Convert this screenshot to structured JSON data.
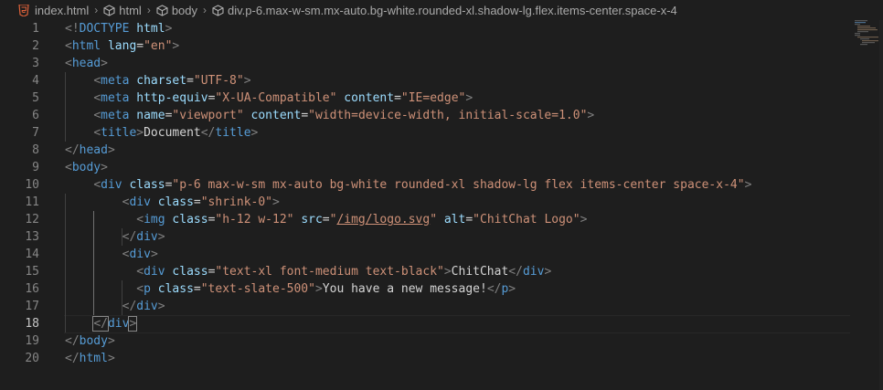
{
  "breadcrumb": [
    {
      "label": "index.html",
      "icon": "html5-icon"
    },
    {
      "label": "html",
      "icon": "cube-icon"
    },
    {
      "label": "body",
      "icon": "cube-icon"
    },
    {
      "label": "div.p-6.max-w-sm.mx-auto.bg-white.rounded-xl.shadow-lg.flex.items-center.space-x-4",
      "icon": "cube-icon"
    }
  ],
  "active_line": 18,
  "lines": [
    {
      "n": "1",
      "parts": [
        [
          "br",
          "<!"
        ],
        [
          "t",
          "DOCTYPE"
        ],
        [
          "tx",
          " "
        ],
        [
          "a",
          "html"
        ],
        [
          "br",
          ">"
        ]
      ]
    },
    {
      "n": "2",
      "parts": [
        [
          "br",
          "<"
        ],
        [
          "t",
          "html"
        ],
        [
          "tx",
          " "
        ],
        [
          "a",
          "lang"
        ],
        [
          "tx",
          "="
        ],
        [
          "s",
          "\"en\""
        ],
        [
          "br",
          ">"
        ]
      ]
    },
    {
      "n": "3",
      "parts": [
        [
          "br",
          "<"
        ],
        [
          "t",
          "head"
        ],
        [
          "br",
          ">"
        ]
      ]
    },
    {
      "n": "4",
      "parts": [
        [
          "tx",
          "    "
        ],
        [
          "br",
          "<"
        ],
        [
          "t",
          "meta"
        ],
        [
          "tx",
          " "
        ],
        [
          "a",
          "charset"
        ],
        [
          "tx",
          "="
        ],
        [
          "s",
          "\"UTF-8\""
        ],
        [
          "br",
          ">"
        ]
      ]
    },
    {
      "n": "5",
      "parts": [
        [
          "tx",
          "    "
        ],
        [
          "br",
          "<"
        ],
        [
          "t",
          "meta"
        ],
        [
          "tx",
          " "
        ],
        [
          "a",
          "http-equiv"
        ],
        [
          "tx",
          "="
        ],
        [
          "s",
          "\"X-UA-Compatible\""
        ],
        [
          "tx",
          " "
        ],
        [
          "a",
          "content"
        ],
        [
          "tx",
          "="
        ],
        [
          "s",
          "\"IE=edge\""
        ],
        [
          "br",
          ">"
        ]
      ]
    },
    {
      "n": "6",
      "parts": [
        [
          "tx",
          "    "
        ],
        [
          "br",
          "<"
        ],
        [
          "t",
          "meta"
        ],
        [
          "tx",
          " "
        ],
        [
          "a",
          "name"
        ],
        [
          "tx",
          "="
        ],
        [
          "s",
          "\"viewport\""
        ],
        [
          "tx",
          " "
        ],
        [
          "a",
          "content"
        ],
        [
          "tx",
          "="
        ],
        [
          "s",
          "\"width=device-width, initial-scale=1.0\""
        ],
        [
          "br",
          ">"
        ]
      ]
    },
    {
      "n": "7",
      "parts": [
        [
          "tx",
          "    "
        ],
        [
          "br",
          "<"
        ],
        [
          "t",
          "title"
        ],
        [
          "br",
          ">"
        ],
        [
          "tx",
          "Document"
        ],
        [
          "br",
          "</"
        ],
        [
          "t",
          "title"
        ],
        [
          "br",
          ">"
        ]
      ]
    },
    {
      "n": "8",
      "parts": [
        [
          "br",
          "</"
        ],
        [
          "t",
          "head"
        ],
        [
          "br",
          ">"
        ]
      ]
    },
    {
      "n": "9",
      "parts": [
        [
          "br",
          "<"
        ],
        [
          "t",
          "body"
        ],
        [
          "br",
          ">"
        ]
      ]
    },
    {
      "n": "10",
      "parts": [
        [
          "tx",
          "    "
        ],
        [
          "br",
          "<"
        ],
        [
          "t",
          "div"
        ],
        [
          "tx",
          " "
        ],
        [
          "a",
          "class"
        ],
        [
          "tx",
          "="
        ],
        [
          "s",
          "\"p-6 max-w-sm mx-auto bg-white rounded-xl shadow-lg flex items-center space-x-4\""
        ],
        [
          "br",
          ">"
        ]
      ]
    },
    {
      "n": "11",
      "parts": [
        [
          "tx",
          "        "
        ],
        [
          "br",
          "<"
        ],
        [
          "t",
          "div"
        ],
        [
          "tx",
          " "
        ],
        [
          "a",
          "class"
        ],
        [
          "tx",
          "="
        ],
        [
          "s",
          "\"shrink-0\""
        ],
        [
          "br",
          ">"
        ]
      ]
    },
    {
      "n": "12",
      "parts": [
        [
          "tx",
          "          "
        ],
        [
          "br",
          "<"
        ],
        [
          "t",
          "img"
        ],
        [
          "tx",
          " "
        ],
        [
          "a",
          "class"
        ],
        [
          "tx",
          "="
        ],
        [
          "s",
          "\"h-12 w-12\""
        ],
        [
          "tx",
          " "
        ],
        [
          "a",
          "src"
        ],
        [
          "tx",
          "="
        ],
        [
          "s",
          "\""
        ],
        [
          "su",
          "/img/logo.svg"
        ],
        [
          "s",
          "\""
        ],
        [
          "tx",
          " "
        ],
        [
          "a",
          "alt"
        ],
        [
          "tx",
          "="
        ],
        [
          "s",
          "\"ChitChat Logo\""
        ],
        [
          "br",
          ">"
        ]
      ]
    },
    {
      "n": "13",
      "parts": [
        [
          "tx",
          "        "
        ],
        [
          "br",
          "</"
        ],
        [
          "t",
          "div"
        ],
        [
          "br",
          ">"
        ]
      ]
    },
    {
      "n": "14",
      "parts": [
        [
          "tx",
          "        "
        ],
        [
          "br",
          "<"
        ],
        [
          "t",
          "div"
        ],
        [
          "br",
          ">"
        ]
      ]
    },
    {
      "n": "15",
      "parts": [
        [
          "tx",
          "          "
        ],
        [
          "br",
          "<"
        ],
        [
          "t",
          "div"
        ],
        [
          "tx",
          " "
        ],
        [
          "a",
          "class"
        ],
        [
          "tx",
          "="
        ],
        [
          "s",
          "\"text-xl font-medium text-black\""
        ],
        [
          "br",
          ">"
        ],
        [
          "tx",
          "ChitChat"
        ],
        [
          "br",
          "</"
        ],
        [
          "t",
          "div"
        ],
        [
          "br",
          ">"
        ]
      ]
    },
    {
      "n": "16",
      "parts": [
        [
          "tx",
          "          "
        ],
        [
          "br",
          "<"
        ],
        [
          "t",
          "p"
        ],
        [
          "tx",
          " "
        ],
        [
          "a",
          "class"
        ],
        [
          "tx",
          "="
        ],
        [
          "s",
          "\"text-slate-500\""
        ],
        [
          "br",
          ">"
        ],
        [
          "tx",
          "You have a new message!"
        ],
        [
          "br",
          "</"
        ],
        [
          "t",
          "p"
        ],
        [
          "br",
          ">"
        ]
      ]
    },
    {
      "n": "17",
      "parts": [
        [
          "tx",
          "        "
        ],
        [
          "br",
          "</"
        ],
        [
          "t",
          "div"
        ],
        [
          "br",
          ">"
        ]
      ]
    },
    {
      "n": "18",
      "parts": [
        [
          "tx",
          "    "
        ],
        [
          "brm",
          "</"
        ],
        [
          "t",
          "div"
        ],
        [
          "brm",
          ">"
        ]
      ]
    },
    {
      "n": "19",
      "parts": [
        [
          "br",
          "</"
        ],
        [
          "t",
          "body"
        ],
        [
          "br",
          ">"
        ]
      ]
    },
    {
      "n": "20",
      "parts": [
        [
          "br",
          "</"
        ],
        [
          "t",
          "html"
        ],
        [
          "br",
          ">"
        ]
      ]
    }
  ]
}
